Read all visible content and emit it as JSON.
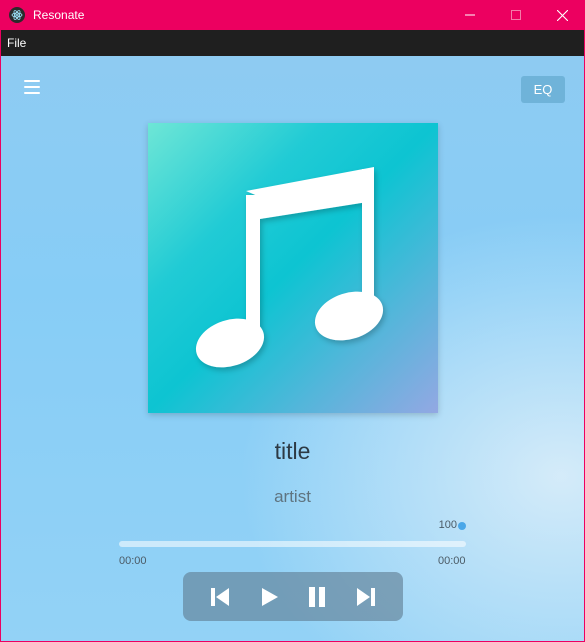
{
  "window": {
    "title": "Resonate",
    "app_icon": "electron-icon",
    "controls": [
      "minimize-icon",
      "maximize-icon",
      "close-icon"
    ]
  },
  "menu": {
    "items": [
      {
        "label": "File"
      }
    ]
  },
  "player": {
    "menu_icon": "hamburger-icon",
    "eq_label": "EQ",
    "album_art_icon": "music-note-icon",
    "title": "title",
    "artist": "artist",
    "volume": "100",
    "progress": 0,
    "time_current": "00:00",
    "time_total": "00:00",
    "controls": [
      {
        "icon": "skip-previous-icon"
      },
      {
        "icon": "play-icon"
      },
      {
        "icon": "pause-icon"
      },
      {
        "icon": "skip-next-icon"
      }
    ]
  },
  "colors": {
    "titlebar": "#ec0060",
    "menubar": "#1f1f1f",
    "background": "#87cdf6",
    "accent": "#4aa7e8"
  }
}
